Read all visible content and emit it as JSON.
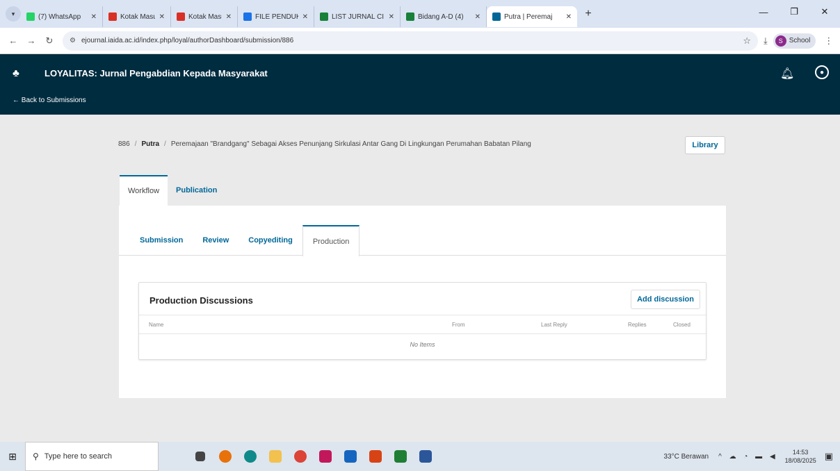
{
  "browser": {
    "tabs": [
      {
        "label": "(7) WhatsApp",
        "color": "#25d366"
      },
      {
        "label": "Kotak Masuk -",
        "color": "#d93025"
      },
      {
        "label": "Kotak Masuk -",
        "color": "#d93025"
      },
      {
        "label": "FILE PENDUKU",
        "color": "#1a73e8"
      },
      {
        "label": "LIST JURNAL CI",
        "color": "#188038"
      },
      {
        "label": "Bidang A-D (4)",
        "color": "#188038"
      },
      {
        "label": "Putra | Peremaj",
        "color": "#006798"
      }
    ],
    "url": "ejournal.iaida.ac.id/index.php/loyal/authorDashboard/submission/886",
    "profile_label": "School",
    "profile_initial": "S"
  },
  "header": {
    "journal_title": "LOYALITAS: Jurnal Pengabdian Kepada Masyarakat",
    "back_link": "← Back to Submissions"
  },
  "breadcrumb": {
    "id": "886",
    "author": "Putra",
    "title": "Peremajaan \"Brandgang\" Sebagai Akses Penunjang Sirkulasi Antar Gang Di Lingkungan Perumahan Babatan Pilang",
    "library_label": "Library"
  },
  "main_tabs": {
    "workflow": "Workflow",
    "publication": "Publication"
  },
  "stage_tabs": {
    "submission": "Submission",
    "review": "Review",
    "copyediting": "Copyediting",
    "production": "Production"
  },
  "discussions": {
    "title": "Production Discussions",
    "add_label": "Add discussion",
    "columns": {
      "name": "Name",
      "from": "From",
      "last_reply": "Last Reply",
      "replies": "Replies",
      "closed": "Closed"
    },
    "empty": "No Items"
  },
  "taskbar": {
    "search_placeholder": "Type here to search",
    "weather": "33°C Berawan",
    "time": "14:53",
    "date": "18/08/2025"
  },
  "colors": {
    "header_bg": "#002c40",
    "accent": "#006798"
  }
}
